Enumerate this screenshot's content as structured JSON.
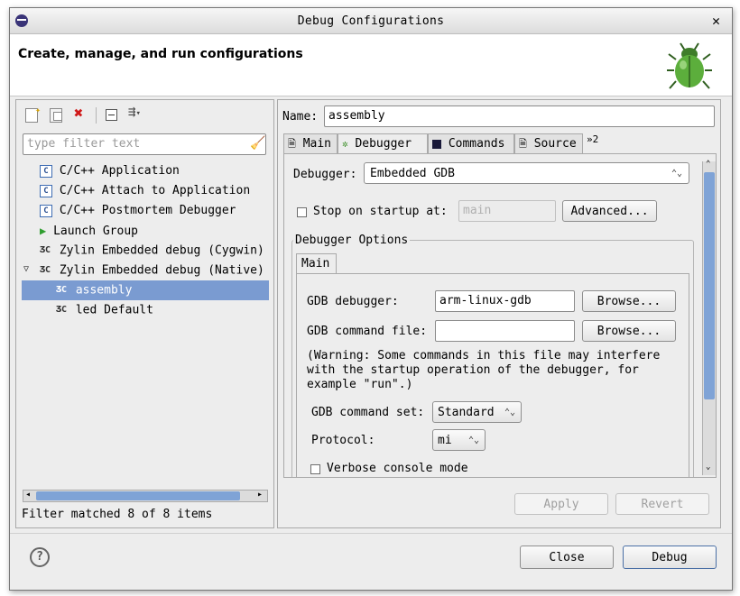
{
  "window": {
    "title": "Debug Configurations"
  },
  "banner": {
    "title": "Create, manage, and run configurations"
  },
  "left": {
    "filter_placeholder": "type filter text",
    "items": [
      {
        "label": "C/C++ Application"
      },
      {
        "label": "C/C++ Attach to Application"
      },
      {
        "label": "C/C++ Postmortem Debugger"
      },
      {
        "label": "Launch Group"
      },
      {
        "label": "Zylin Embedded debug (Cygwin)"
      },
      {
        "label": "Zylin Embedded debug (Native)"
      },
      {
        "label": "assembly"
      },
      {
        "label": "led Default"
      }
    ],
    "status": "Filter matched 8 of 8 items"
  },
  "right": {
    "name_label": "Name:",
    "name_value": "assembly",
    "tabs": [
      {
        "label": "Main"
      },
      {
        "label": "Debugger"
      },
      {
        "label": "Commands"
      },
      {
        "label": "Source"
      },
      {
        "label": "»2"
      }
    ],
    "debugger_label": "Debugger:",
    "debugger_value": "Embedded GDB",
    "stop_label": "Stop on startup at:",
    "stop_value": "main",
    "advanced_label": "Advanced...",
    "options_group": "Debugger Options",
    "inner_tab": "Main",
    "gdb_debugger_label": "GDB debugger:",
    "gdb_debugger_value": "arm-linux-gdb",
    "browse1": "Browse...",
    "gdb_cmdfile_label": "GDB command file:",
    "gdb_cmdfile_value": "",
    "browse2": "Browse...",
    "warning": "(Warning: Some commands in this file may interfere\nwith the startup operation of the debugger, for\nexample \"run\".)",
    "cmdset_label": "GDB command set:",
    "cmdset_value": "Standard",
    "protocol_label": "Protocol:",
    "protocol_value": "mi",
    "verbose_label": "Verbose console mode",
    "apply": "Apply",
    "revert": "Revert"
  },
  "footer": {
    "close": "Close",
    "debug": "Debug"
  }
}
